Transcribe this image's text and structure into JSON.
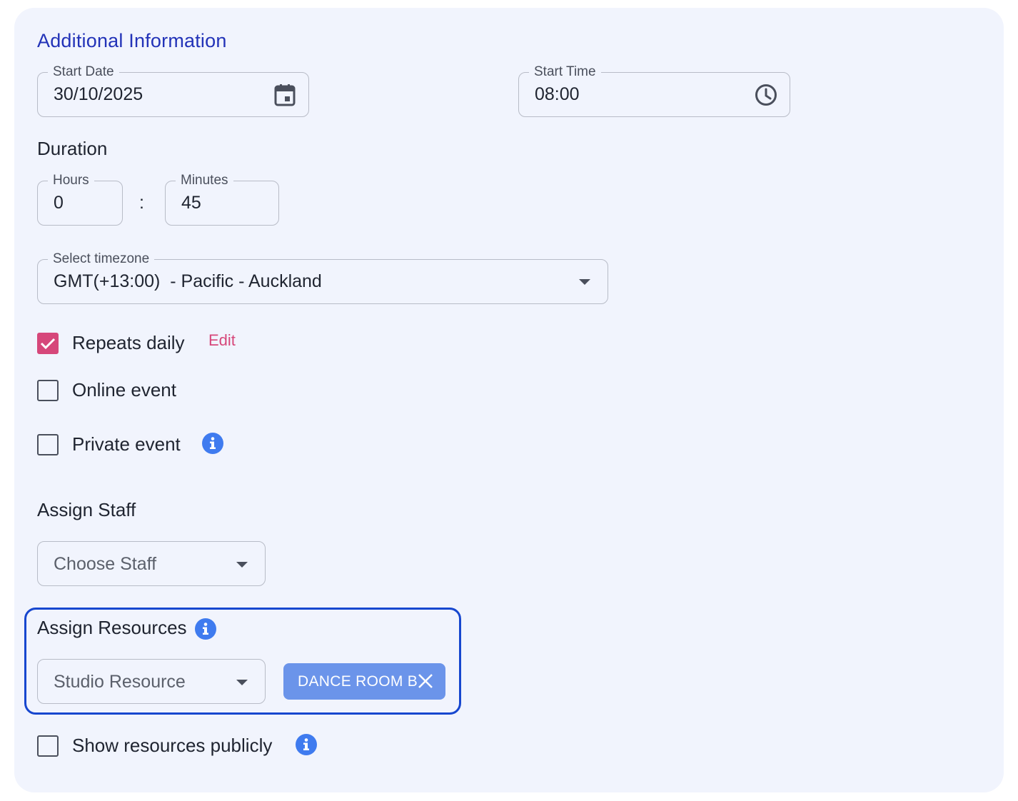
{
  "section_title": "Additional Information",
  "start_date": {
    "label": "Start Date",
    "value": "30/10/2025",
    "icon": "calendar-icon"
  },
  "start_time": {
    "label": "Start Time",
    "value": "08:00",
    "icon": "clock-icon"
  },
  "duration": {
    "heading": "Duration",
    "hours": {
      "label": "Hours",
      "value": "0"
    },
    "separator": ":",
    "minutes": {
      "label": "Minutes",
      "value": "45"
    }
  },
  "timezone": {
    "label": "Select timezone",
    "value": "GMT(+13:00)  - Pacific - Auckland"
  },
  "options": {
    "repeats_daily": {
      "label": "Repeats daily",
      "checked": true,
      "edit_label": "Edit"
    },
    "online_event": {
      "label": "Online event",
      "checked": false
    },
    "private_event": {
      "label": "Private event",
      "checked": false
    }
  },
  "assign_staff": {
    "heading": "Assign Staff",
    "placeholder": "Choose Staff"
  },
  "assign_resources": {
    "heading": "Assign Resources",
    "placeholder": "Studio Resource",
    "chips": [
      {
        "label": "DANCE ROOM B"
      }
    ]
  },
  "show_resources_publicly": {
    "label": "Show resources publicly",
    "checked": false
  },
  "colors": {
    "accent_pink": "#d6477a",
    "title_blue": "#2333b8",
    "info_blue": "#3f7bef",
    "chip_blue": "#6b94ea",
    "highlight_blue": "#1747cf"
  }
}
